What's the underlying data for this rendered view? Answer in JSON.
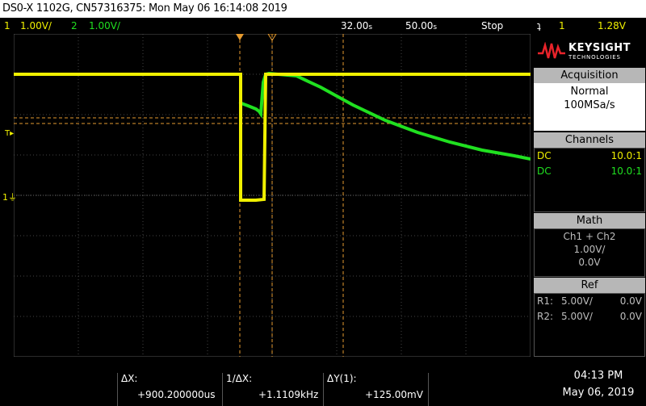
{
  "title": "DS0-X 1102G, CN57316375: Mon May 06 16:14:08 2019",
  "status": {
    "ch1_num": "1",
    "ch1_scale": "1.00V/",
    "ch2_num": "2",
    "ch2_scale": "1.00V/",
    "delay": "32.00",
    "delay_unit": "s",
    "timebase": "50.00",
    "timebase_unit": "s",
    "run_state": "Stop",
    "trigger_icon": "trigger-edge-icon",
    "trigger_ch": "1",
    "trigger_level": "1.28V"
  },
  "logo": {
    "brand": "KEYSIGHT",
    "sub": "TECHNOLOGIES",
    "color": "#e8232a"
  },
  "acquisition": {
    "header": "Acquisition",
    "mode": "Normal",
    "rate": "100MSa/s"
  },
  "channels": {
    "header": "Channels",
    "rows": [
      {
        "coupling": "DC",
        "probe": "10.0:1",
        "color": "#f0f000"
      },
      {
        "coupling": "DC",
        "probe": "10.0:1",
        "color": "#20e020"
      }
    ]
  },
  "math": {
    "header": "Math",
    "expr": "Ch1 + Ch2",
    "scale": "1.00V/",
    "offset": "0.0V"
  },
  "ref": {
    "header": "Ref",
    "rows": [
      {
        "name": "R1:",
        "scale": "5.00V/",
        "offset": "0.0V"
      },
      {
        "name": "R2:",
        "scale": "5.00V/",
        "offset": "0.0V"
      }
    ]
  },
  "measurements": {
    "dx_label": "ΔX:",
    "dx_value": "+900.200000us",
    "inv_dx_label": "1/ΔX:",
    "inv_dx_value": "+1.1109kHz",
    "dy_label": "ΔY(1):",
    "dy_value": "+125.00mV"
  },
  "clock": {
    "time": "04:13 PM",
    "date": "May 06, 2019"
  },
  "markers": {
    "trigger_label": "T",
    "ground_label": "1"
  },
  "colors": {
    "ch1": "#f0f000",
    "ch2": "#20e020",
    "cursor": "#e59a2f",
    "grid": "#555555"
  }
}
